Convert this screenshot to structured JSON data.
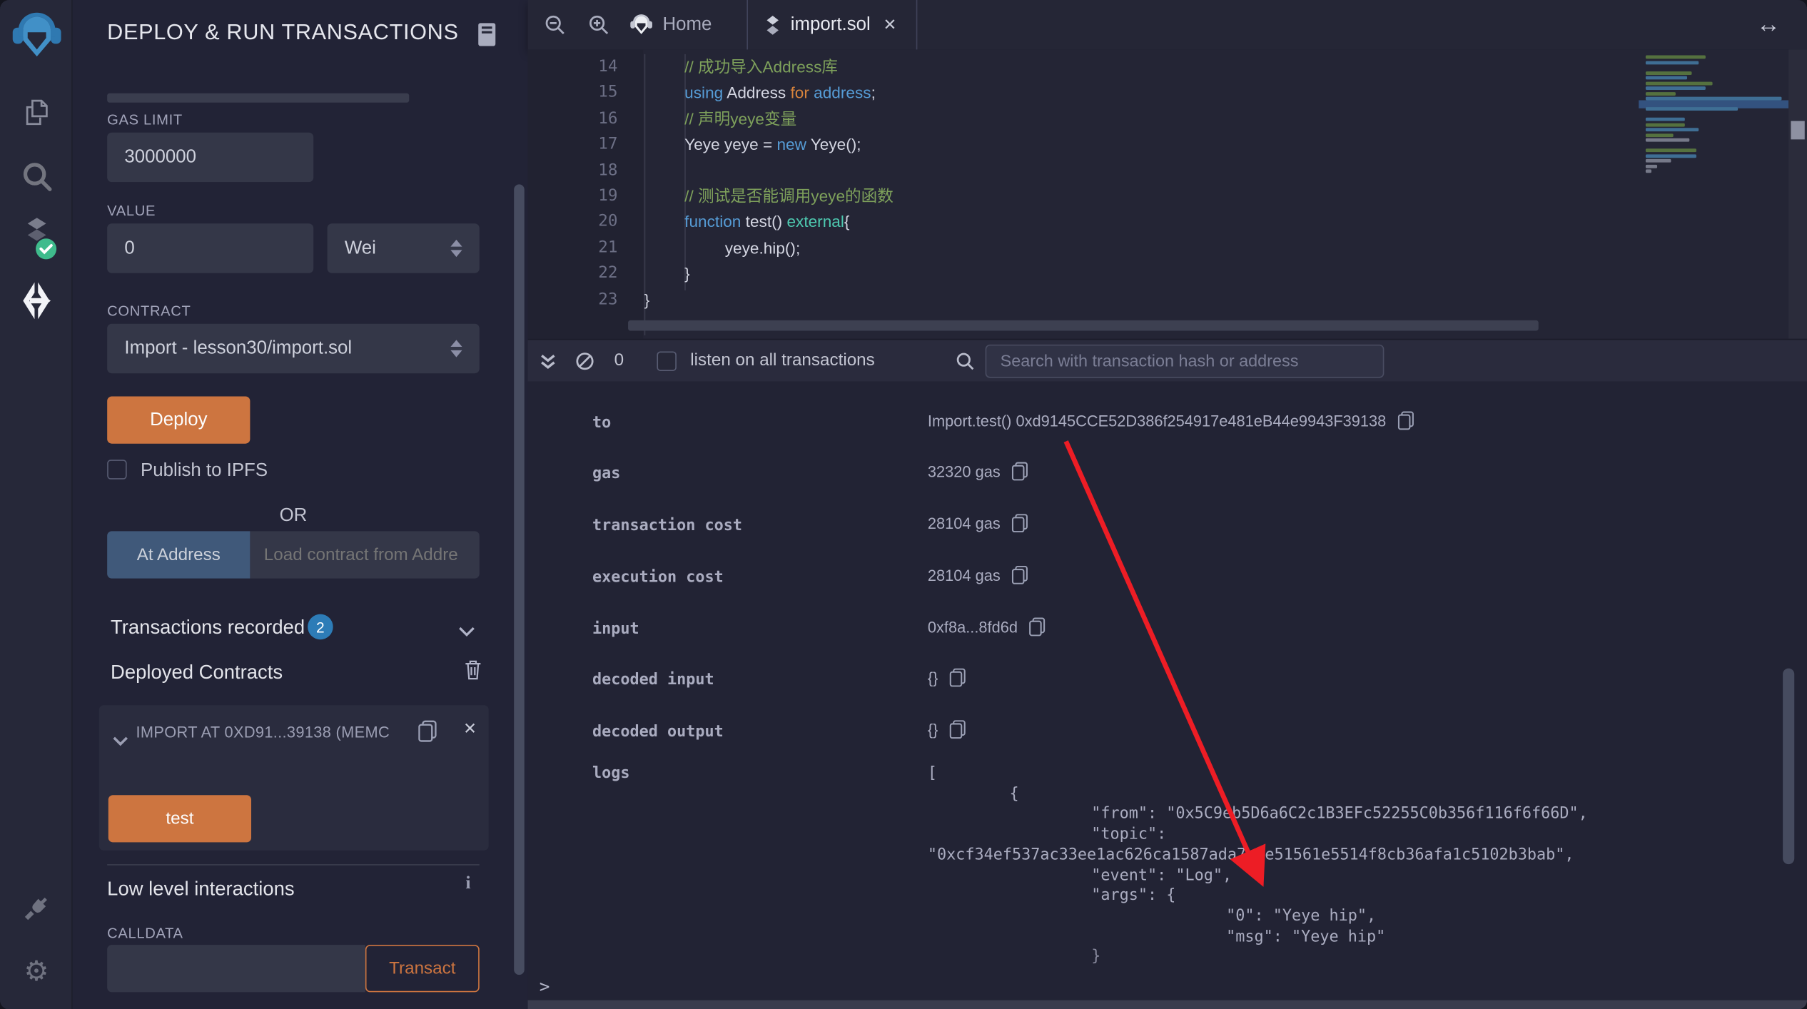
{
  "panel": {
    "title": "DEPLOY & RUN TRANSACTIONS",
    "gas_limit_label": "GAS LIMIT",
    "gas_limit_value": "3000000",
    "value_label": "VALUE",
    "value_value": "0",
    "value_unit": "Wei",
    "contract_label": "CONTRACT",
    "contract_value": "Import - lesson30/import.sol",
    "deploy_button": "Deploy",
    "publish_label": "Publish to IPFS",
    "or_label": "OR",
    "at_address_button": "At Address",
    "at_address_placeholder": "Load contract from Addre",
    "transactions_recorded_label": "Transactions recorded",
    "transactions_recorded_count": "2",
    "deployed_contracts_label": "Deployed Contracts",
    "deployed_contract_title": "IMPORT AT 0XD91...39138 (MEMC",
    "test_button": "test",
    "low_level_label": "Low level interactions",
    "calldata_label": "CALLDATA",
    "transact_button": "Transact"
  },
  "editor": {
    "tabs": {
      "home": "Home",
      "file": "import.sol"
    },
    "lines": [
      {
        "n": "14",
        "ind": 1,
        "tok": [
          [
            "c",
            "// 成功导入Address库"
          ]
        ]
      },
      {
        "n": "15",
        "ind": 1,
        "tok": [
          [
            "k",
            "using"
          ],
          [
            "p",
            " Address "
          ],
          [
            "o",
            "for"
          ],
          [
            "k",
            " address"
          ],
          [
            "p",
            ";"
          ]
        ]
      },
      {
        "n": "16",
        "ind": 1,
        "tok": [
          [
            "c",
            "// 声明yeye变量"
          ]
        ]
      },
      {
        "n": "17",
        "ind": 1,
        "tok": [
          [
            "p",
            "Yeye yeye = "
          ],
          [
            "k",
            "new"
          ],
          [
            "p",
            " Yeye();"
          ]
        ]
      },
      {
        "n": "18",
        "ind": 1,
        "tok": []
      },
      {
        "n": "19",
        "ind": 1,
        "tok": [
          [
            "c",
            "// 测试是否能调用yeye的函数"
          ]
        ]
      },
      {
        "n": "20",
        "ind": 1,
        "tok": [
          [
            "k",
            "function"
          ],
          [
            "p",
            " test() "
          ],
          [
            "t",
            "external"
          ],
          [
            "p",
            "{"
          ]
        ]
      },
      {
        "n": "21",
        "ind": 2,
        "tok": [
          [
            "p",
            "yeye.hip();"
          ]
        ]
      },
      {
        "n": "22",
        "ind": 1,
        "tok": [
          [
            "p",
            "}"
          ]
        ]
      },
      {
        "n": "23",
        "ind": 0,
        "tok": [
          [
            "p",
            "}"
          ]
        ]
      }
    ],
    "minimap": [
      [
        "c",
        52
      ],
      [
        "k",
        46
      ],
      [
        "x",
        0
      ],
      [
        "c",
        40
      ],
      [
        "k",
        36
      ],
      [
        "c",
        58
      ],
      [
        "k",
        52
      ],
      [
        "c",
        26
      ],
      [
        "k",
        118
      ],
      [
        "hl",
        130
      ],
      [
        "k",
        80
      ],
      [
        "x",
        0
      ],
      [
        "k",
        34
      ],
      [
        "c",
        34
      ],
      [
        "k",
        46
      ],
      [
        "c",
        24
      ],
      [
        "p",
        38
      ],
      [
        "x",
        0
      ],
      [
        "c",
        44
      ],
      [
        "k",
        44
      ],
      [
        "p",
        22
      ],
      [
        "p",
        10
      ],
      [
        "p",
        5
      ]
    ]
  },
  "terminal": {
    "pending_count": "0",
    "listen_label": "listen on all transactions",
    "search_placeholder": "Search with transaction hash or address",
    "rows": [
      [
        "to",
        "Import.test() 0xd9145CCE52D386f254917e481eB44e9943F39138"
      ],
      [
        "gas",
        "32320 gas"
      ],
      [
        "transaction cost",
        "28104 gas"
      ],
      [
        "execution cost",
        "28104 gas"
      ],
      [
        "input",
        "0xf8a...8fd6d"
      ],
      [
        "decoded input",
        "{}"
      ],
      [
        "decoded output",
        "{}"
      ]
    ],
    "logs_label": "logs",
    "logs": [
      [
        0,
        "["
      ],
      [
        1,
        "{"
      ],
      [
        2,
        "\"from\": \"0x5C9eb5D6a6C2c1B3EFc52255C0b356f116f6f66D\","
      ],
      [
        2,
        "\"topic\":"
      ],
      [
        0,
        "\"0xcf34ef537ac33ee1ac626ca1587ada7e8e51561e5514f8cb36afa1c5102b3bab\","
      ],
      [
        2,
        "\"event\": \"Log\","
      ],
      [
        2,
        "\"args\": {"
      ],
      [
        3,
        "\"0\": \"Yeye hip\","
      ],
      [
        3,
        "\"msg\": \"Yeye hip\""
      ],
      [
        2,
        "}"
      ]
    ],
    "prompt": ">"
  },
  "colors": {
    "accent_orange": "#cd7540",
    "badge_blue": "#2d7cb7",
    "success_green": "#3fbb8c",
    "arrow_red": "#ed1d25"
  }
}
